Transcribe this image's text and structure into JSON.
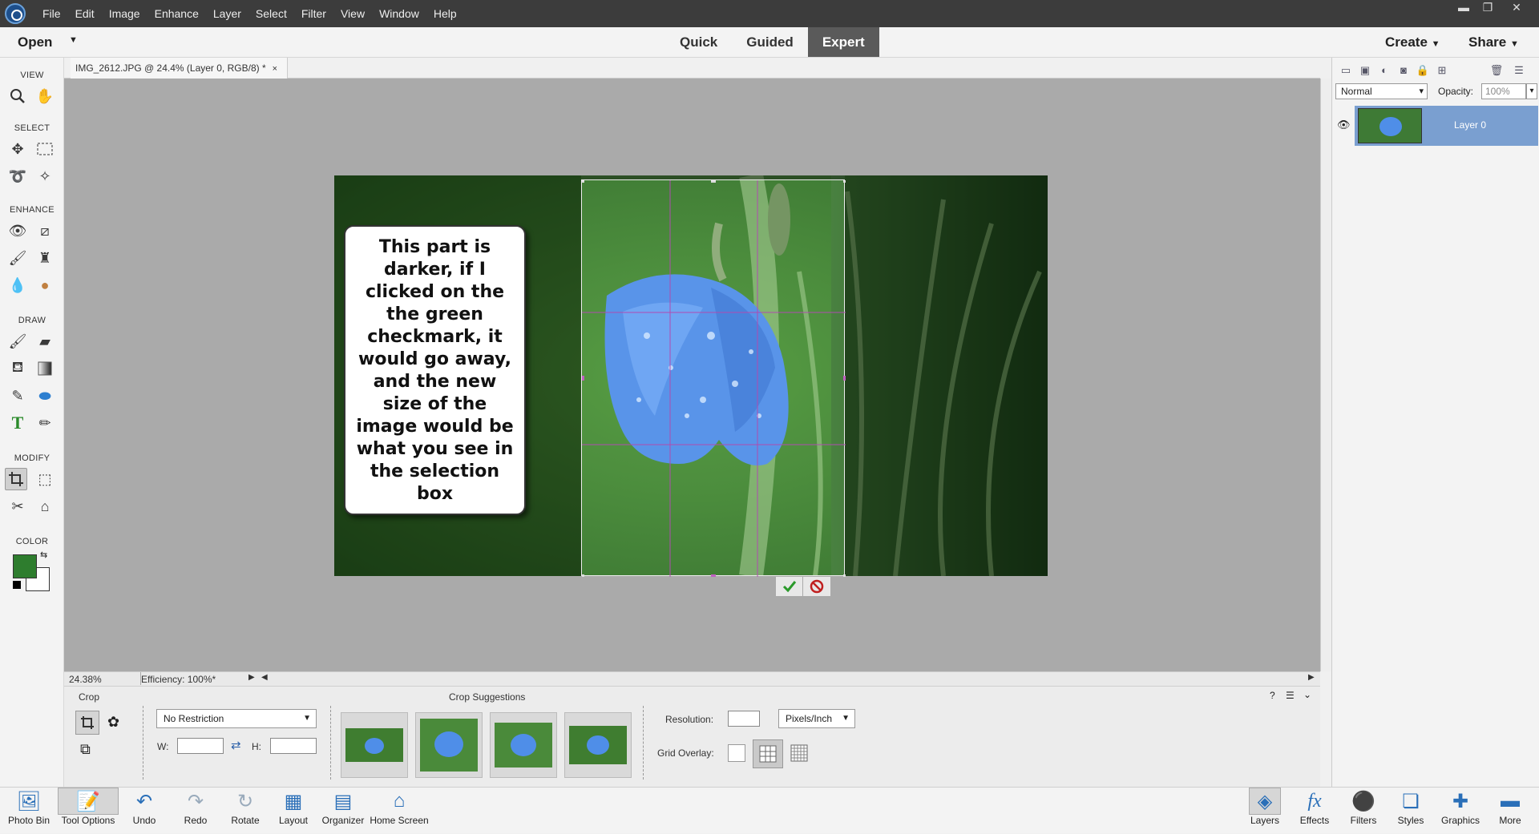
{
  "menubar": {
    "items": [
      "File",
      "Edit",
      "Image",
      "Enhance",
      "Layer",
      "Select",
      "Filter",
      "View",
      "Window",
      "Help"
    ],
    "win_min": "▬",
    "win_restore": "❐",
    "win_close": "✕"
  },
  "modebar": {
    "open": "Open",
    "modes": [
      "Quick",
      "Guided",
      "Expert"
    ],
    "active_mode": "Expert",
    "create": "Create",
    "share": "Share"
  },
  "toolbox": {
    "sections": [
      "VIEW",
      "SELECT",
      "ENHANCE",
      "DRAW",
      "MODIFY",
      "COLOR"
    ],
    "foreground_color": "#2e7d2e",
    "background_color": "#ffffff"
  },
  "document": {
    "tab_title": "IMG_2612.JPG @ 24.4% (Layer 0, RGB/8) *",
    "close": "×",
    "annotation": "This part is darker, if I clicked on the the green checkmark, it would go away, and the new size of the image would be what you see in the selection box"
  },
  "status": {
    "zoom": "24.38%",
    "efficiency": "Efficiency: 100%*"
  },
  "layers": {
    "blend_mode": "Normal",
    "opacity_label": "Opacity:",
    "opacity": "100%",
    "layer_name": "Layer 0"
  },
  "tool_options": {
    "tool_name": "Crop",
    "suggestions_title": "Crop Suggestions",
    "restriction": "No Restriction",
    "w_label": "W:",
    "h_label": "H:",
    "resolution_label": "Resolution:",
    "resolution_unit": "Pixels/Inch",
    "grid_overlay_label": "Grid Overlay:"
  },
  "taskbar": {
    "left": [
      "Photo Bin",
      "Tool Options",
      "Undo",
      "Redo",
      "Rotate",
      "Layout",
      "Organizer",
      "Home Screen"
    ],
    "right": [
      "Layers",
      "Effects",
      "Filters",
      "Styles",
      "Graphics",
      "More"
    ]
  },
  "colors": {
    "accent_blue": "#7a9fd0",
    "mode_active": "#5a5a5a",
    "canvas_bg": "#aaaaaa",
    "selection_line": "#b04bb0"
  }
}
